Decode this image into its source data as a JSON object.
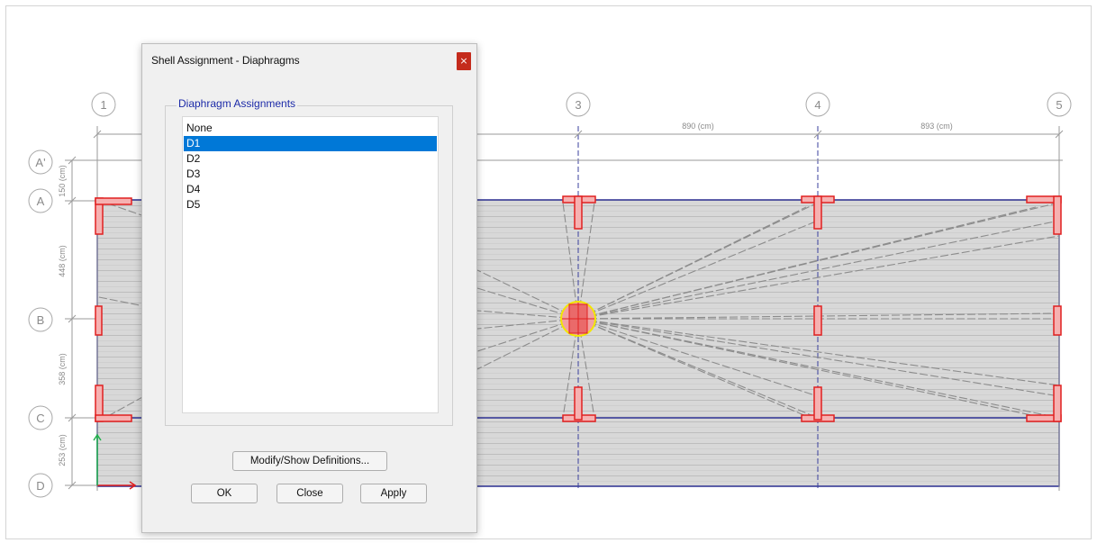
{
  "model_view": {
    "grid_x_labels": [
      "1",
      "3",
      "4",
      "5"
    ],
    "grid_y_labels": [
      "A'",
      "A",
      "B",
      "C",
      "D"
    ],
    "x_dimensions": [
      "890 (cm)",
      "893 (cm)"
    ],
    "y_dimensions": [
      "150 (cm)",
      "448 (cm)",
      "358 (cm)",
      "253 (cm)"
    ],
    "colors": {
      "grid_line": "#9a9a9a",
      "bubble": "#a8a8a8",
      "slab_fill": "#d6d6d6",
      "slab_stripe": "#c4c4c4",
      "beam": "#2b2f91",
      "wall_outline": "#e02020",
      "wall_fill": "#f49a9a",
      "diaphragm_line": "#8c8c8c",
      "center_mark": "#f2e600"
    }
  },
  "dialog": {
    "title": "Shell Assignment - Diaphragms",
    "close_glyph": "×",
    "group_label": "Diaphragm Assignments",
    "list_items": [
      "None",
      "D1",
      "D2",
      "D3",
      "D4",
      "D5"
    ],
    "selected_item": "D1",
    "buttons": {
      "modify": "Modify/Show Definitions...",
      "ok": "OK",
      "close": "Close",
      "apply": "Apply"
    }
  }
}
